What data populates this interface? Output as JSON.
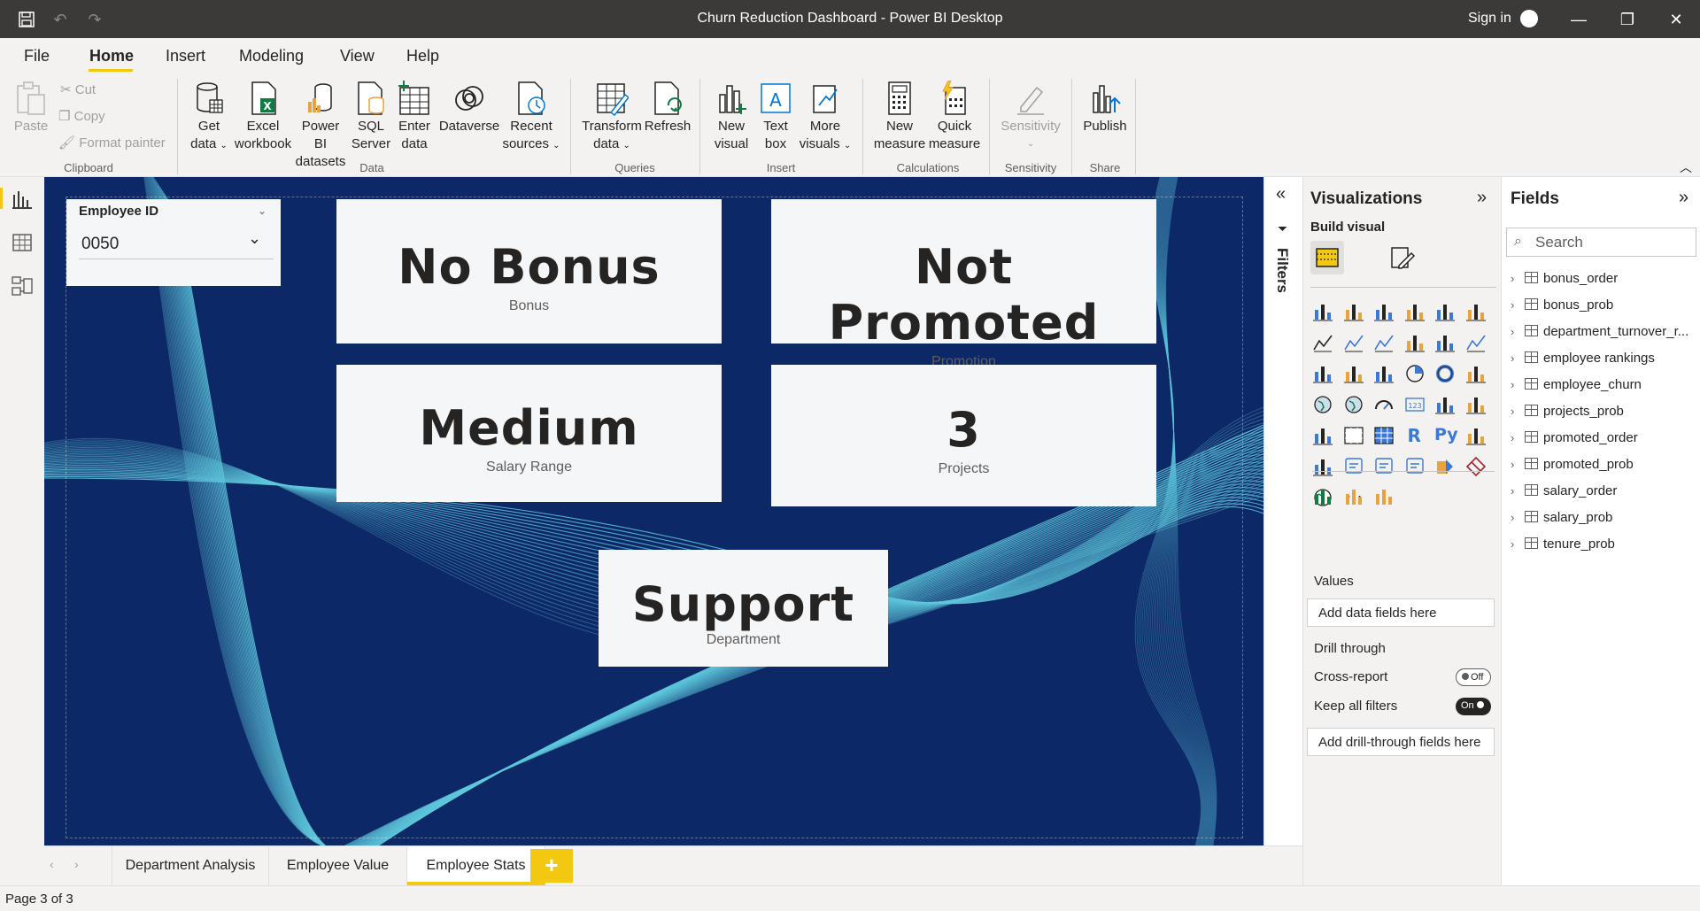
{
  "window": {
    "title": "Churn Reduction Dashboard - Power BI Desktop",
    "sign_in": "Sign in"
  },
  "menu": [
    "File",
    "Home",
    "Insert",
    "Modeling",
    "View",
    "Help"
  ],
  "ribbon": {
    "clipboard": {
      "paste": "Paste",
      "cut": "Cut",
      "copy": "Copy",
      "format_painter": "Format painter",
      "group": "Clipboard"
    },
    "data": {
      "get_data_1": "Get",
      "get_data_2": "data",
      "excel_1": "Excel",
      "excel_2": "workbook",
      "pbi_1": "Power BI",
      "pbi_2": "datasets",
      "sql_1": "SQL",
      "sql_2": "Server",
      "enter_1": "Enter",
      "enter_2": "data",
      "dataverse": "Dataverse",
      "recent_1": "Recent",
      "recent_2": "sources",
      "group": "Data"
    },
    "queries": {
      "transform_1": "Transform",
      "transform_2": "data",
      "refresh": "Refresh",
      "group": "Queries"
    },
    "insert": {
      "new_visual_1": "New",
      "new_visual_2": "visual",
      "text_box_1": "Text",
      "text_box_2": "box",
      "more_1": "More",
      "more_2": "visuals",
      "group": "Insert"
    },
    "calculations": {
      "new_measure_1": "New",
      "new_measure_2": "measure",
      "quick_measure_1": "Quick",
      "quick_measure_2": "measure",
      "group": "Calculations"
    },
    "sensitivity": {
      "label": "Sensitivity",
      "group": "Sensitivity"
    },
    "share": {
      "publish": "Publish",
      "group": "Share"
    }
  },
  "report": {
    "slicer": {
      "label": "Employee ID",
      "value": "0050"
    },
    "cards": {
      "bonus": {
        "value": "No Bonus",
        "caption": "Bonus"
      },
      "promotion": {
        "value": "Not Promoted",
        "caption": "Promotion"
      },
      "salary": {
        "value": "Medium",
        "caption": "Salary Range"
      },
      "projects": {
        "value": "3",
        "caption": "Projects"
      },
      "department": {
        "value": "Support",
        "caption": "Department"
      }
    }
  },
  "filters_label": "Filters",
  "visualizations": {
    "title": "Visualizations",
    "build_visual": "Build visual",
    "values_label": "Values",
    "values_placeholder": "Add data fields here",
    "drill_through": "Drill through",
    "cross_report": "Cross-report",
    "cross_report_state": "Off",
    "keep_filters": "Keep all filters",
    "keep_filters_state": "On",
    "drill_placeholder": "Add drill-through fields here",
    "r_label": "R",
    "py_label": "Py",
    "more": "···"
  },
  "fields": {
    "title": "Fields",
    "search_placeholder": "Search",
    "tables": [
      "bonus_order",
      "bonus_prob",
      "department_turnover_r...",
      "employee rankings",
      "employee_churn",
      "projects_prob",
      "promoted_order",
      "promoted_prob",
      "salary_order",
      "salary_prob",
      "tenure_prob"
    ]
  },
  "tabs": [
    "Department Analysis",
    "Employee Value",
    "Employee Stats"
  ],
  "active_tab": "Employee Stats",
  "status": "Page 3 of 3",
  "colors": {
    "accent": "#f2c811",
    "canvas": "#0d2866",
    "wave": "#5ec8dd"
  }
}
